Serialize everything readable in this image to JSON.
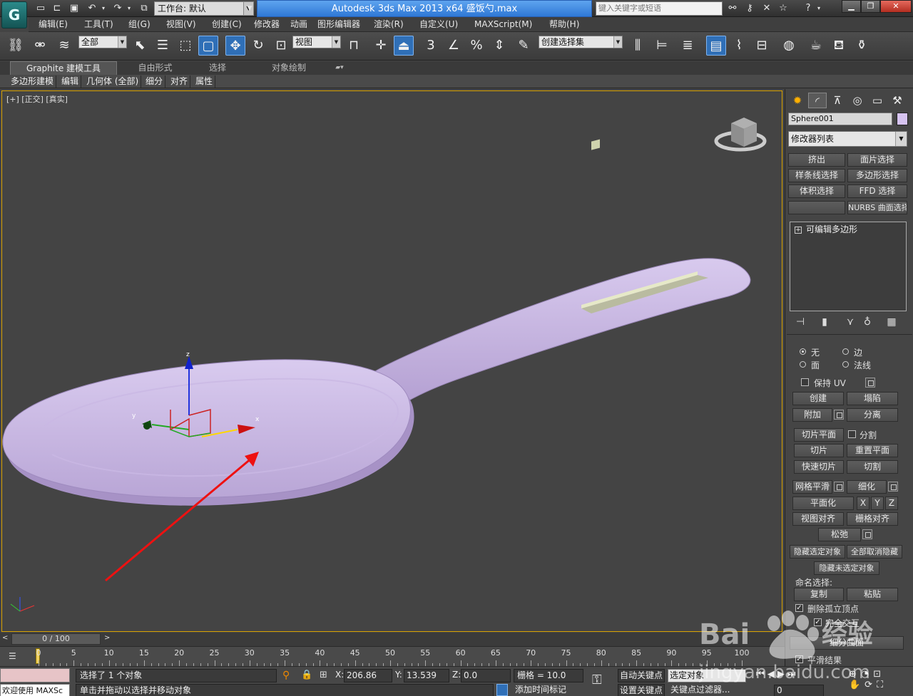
{
  "app": {
    "title": "Autodesk 3ds Max  2013 x64     盛饭勺.max",
    "logo": "G",
    "workspace": "工作台: 默认",
    "search_placeholder": "键入关键字或短语"
  },
  "menu": [
    "编辑(E)",
    "工具(T)",
    "组(G)",
    "视图(V)",
    "创建(C)",
    "修改器",
    "动画",
    "图形编辑器",
    "渲染(R)",
    "自定义(U)",
    "MAXScript(M)",
    "帮助(H)"
  ],
  "toolbar": {
    "filter": "全部",
    "ref_coord": "视图",
    "selection_set": "创建选择集",
    "snap_labels": [
      "3",
      "%"
    ]
  },
  "ribbon": {
    "tabs": [
      "Graphite 建模工具",
      "自由形式",
      "选择",
      "对象绘制"
    ],
    "buttons": [
      "多边形建模",
      "编辑",
      "几何体 (全部)",
      "细分",
      "对齐",
      "属性"
    ]
  },
  "viewport": {
    "label": "[+] [正交] [真实]",
    "axes": {
      "x": "x",
      "y": "y",
      "z": "z"
    },
    "mesh_color": "#d3c2ec",
    "arrow_color": "#ee1111",
    "frame_color": "#d9a200"
  },
  "panel": {
    "object_name": "Sphere001",
    "object_color": "#d6c3f0",
    "modifier_list": "修改器列表",
    "modifier_buttons": [
      "挤出",
      "面片选择",
      "样条线选择",
      "多边形选择",
      "体积选择",
      "FFD 选择",
      "",
      "NURBS 曲面选择"
    ],
    "stack_item": "可编辑多边形",
    "constraints": {
      "none": "无",
      "edge": "边",
      "face": "面",
      "normal": "法线"
    },
    "preserve_uv": "保持 UV",
    "buttons": {
      "create": "创建",
      "collapse": "塌陷",
      "attach": "附加",
      "detach": "分离",
      "slice_plane": "切片平面",
      "split": "分割",
      "slice": "切片",
      "reset_plane": "重置平面",
      "quickslice": "快速切片",
      "cut": "切割",
      "meshsmooth": "网格平滑",
      "tessellate": "细化",
      "make_planar": "平面化",
      "x": "X",
      "y": "Y",
      "z": "Z",
      "view_align": "视图对齐",
      "grid_align": "栅格对齐",
      "relax": "松弛",
      "hide_selected": "隐藏选定对象",
      "unhide_all": "全部取消隐藏",
      "hide_unselected": "隐藏未选定对象",
      "named_selections": "命名选择:",
      "copy": "复制",
      "paste": "粘贴",
      "delete_isolated": "删除孤立顶点",
      "full_interactivity": "完全交互",
      "subdivision": "细分曲面",
      "smooth_result": "平滑结果"
    }
  },
  "timeline": {
    "slider": "0 / 100",
    "ticks": [
      0,
      5,
      10,
      15,
      20,
      25,
      30,
      35,
      40,
      45,
      50,
      55,
      60,
      65,
      70,
      75,
      80,
      85,
      90,
      95,
      100
    ]
  },
  "status": {
    "maxscript": "欢迎使用 MAXSc",
    "selection": "选择了 1 个对象",
    "prompt": "单击并拖动以选择并移动对象",
    "x_label": "X:",
    "x": "206.86",
    "y_label": "Y:",
    "y": "13.539",
    "z_label": "Z:",
    "z": "0.0",
    "grid": "栅格 = 10.0",
    "auto_key": "自动关键点",
    "set_key": "设置关键点",
    "selected_object": "选定对象",
    "key_filters": "关键点过滤器...",
    "add_time_tag": "添加时间标记",
    "frame": "0"
  },
  "watermark": {
    "text": "Bai",
    "text2": "经验",
    "url": "jingyan.baidu.com"
  }
}
